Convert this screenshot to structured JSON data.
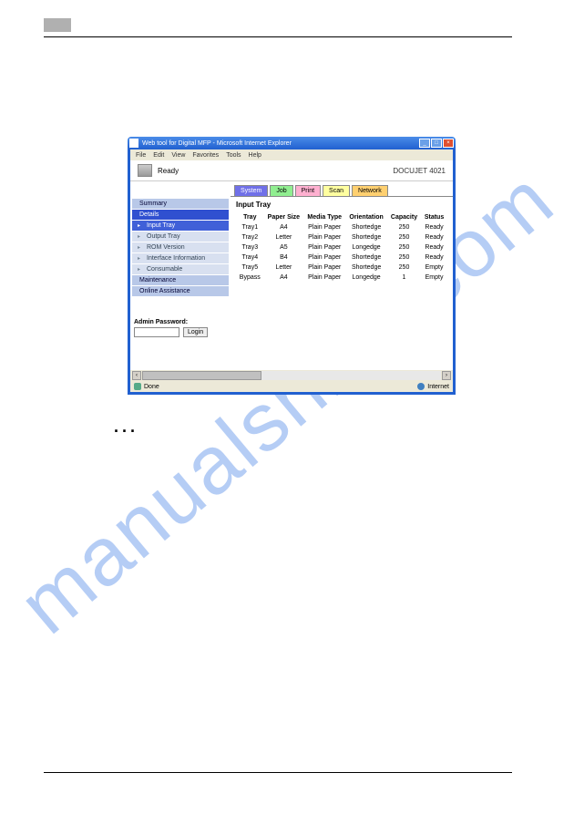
{
  "watermark": "manualshive.com",
  "dots": "...",
  "browser": {
    "title": "Web tool for Digital MFP - Microsoft Internet Explorer",
    "menu": [
      "File",
      "Edit",
      "View",
      "Favorites",
      "Tools",
      "Help"
    ],
    "ready": "Ready",
    "model": "DOCUJET 4021",
    "tabs": {
      "system": "System",
      "job": "Job",
      "print": "Print",
      "scan": "Scan",
      "network": "Network"
    },
    "sidebar": {
      "summary": "Summary",
      "details": "Details",
      "input_tray": "Input Tray",
      "output_tray": "Output Tray",
      "rom_version": "ROM Version",
      "interface": "Interface Information",
      "consumable": "Consumable",
      "maintenance": "Maintenance",
      "online_assist": "Online Assistance"
    },
    "admin": {
      "label": "Admin Password:",
      "login": "Login"
    },
    "panel_title": "Input Tray",
    "table": {
      "headers": [
        "Tray",
        "Paper Size",
        "Media Type",
        "Orientation",
        "Capacity",
        "Status"
      ],
      "rows": [
        [
          "Tray1",
          "A4",
          "Plain Paper",
          "Shortedge",
          "250",
          "Ready"
        ],
        [
          "Tray2",
          "Letter",
          "Plain Paper",
          "Shortedge",
          "250",
          "Ready"
        ],
        [
          "Tray3",
          "A5",
          "Plain Paper",
          "Longedge",
          "250",
          "Ready"
        ],
        [
          "Tray4",
          "B4",
          "Plain Paper",
          "Shortedge",
          "250",
          "Ready"
        ],
        [
          "Tray5",
          "Letter",
          "Plain Paper",
          "Shortedge",
          "250",
          "Empty"
        ],
        [
          "Bypass",
          "A4",
          "Plain Paper",
          "Longedge",
          "1",
          "Empty"
        ]
      ]
    },
    "status": {
      "done": "Done",
      "internet": "Internet"
    }
  }
}
